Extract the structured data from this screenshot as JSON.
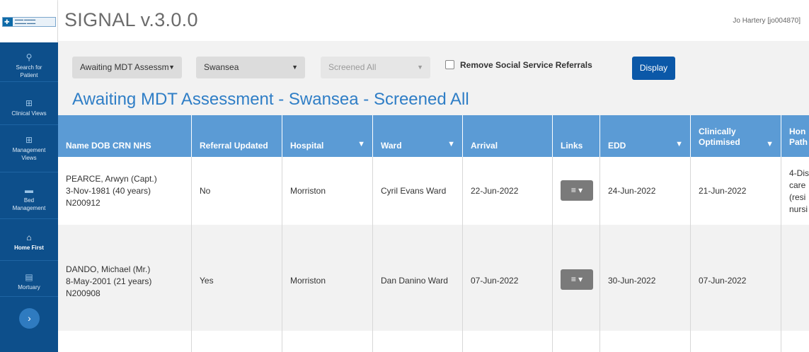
{
  "header": {
    "app_title": "SIGNAL v.3.0.0",
    "user": "Jo Hartery [jo004870]"
  },
  "sidebar": {
    "items": [
      {
        "icon": "search-icon",
        "label": "Search for Patient"
      },
      {
        "icon": "grid-icon",
        "label": "Clinical Views"
      },
      {
        "icon": "grid-icon",
        "label": "Management Views"
      },
      {
        "icon": "bed-icon",
        "label": "Bed Management"
      },
      {
        "icon": "home-icon",
        "label": "Home First"
      },
      {
        "icon": "book-icon",
        "label": "Mortuary"
      }
    ],
    "expand_label": "›"
  },
  "filters": {
    "status": "Awaiting MDT Assessm",
    "location": "Swansea",
    "screened": "Screened All",
    "remove_social_label": "Remove Social Service Referrals",
    "remove_social_checked": false,
    "display_label": "Display"
  },
  "page": {
    "heading": "Awaiting MDT Assessment - Swansea - Screened All"
  },
  "table": {
    "columns": [
      {
        "label": "Name DOB CRN NHS",
        "filter": false
      },
      {
        "label": "Referral Updated",
        "filter": false
      },
      {
        "label": "Hospital",
        "filter": true
      },
      {
        "label": "Ward",
        "filter": true
      },
      {
        "label": "Arrival",
        "filter": false
      },
      {
        "label": "Links",
        "filter": false
      },
      {
        "label": "EDD",
        "filter": true
      },
      {
        "label": "Clinically Optimised",
        "filter": true
      },
      {
        "label": "Hon Path",
        "filter": false
      }
    ],
    "rows": [
      {
        "name": "PEARCE, Arwyn (Capt.)",
        "dob": "3-Nov-1981 (40 years)",
        "crn": "N200912",
        "referral_updated": "No",
        "hospital": "Morriston",
        "ward": "Cyril Evans Ward",
        "arrival": "22-Jun-2022",
        "links_label": "≡ ▾",
        "edd": "24-Jun-2022",
        "clinically_optimised": "21-Jun-2022",
        "pathway": [
          "4-Dis",
          "care",
          "(resi",
          "nursi"
        ]
      },
      {
        "name": "DANDO, Michael (Mr.)",
        "dob": "8-May-2001 (21 years)",
        "crn": "N200908",
        "referral_updated": "Yes",
        "hospital": "Morriston",
        "ward": "Dan Danino Ward",
        "arrival": "07-Jun-2022",
        "links_label": "≡ ▾",
        "edd": "30-Jun-2022",
        "clinically_optimised": "07-Jun-2022",
        "pathway": []
      }
    ]
  },
  "colors": {
    "sidebar": "#0d4f8b",
    "table_header": "#5b9bd5",
    "heading": "#2f7ec6",
    "display_button": "#0b58a8"
  }
}
